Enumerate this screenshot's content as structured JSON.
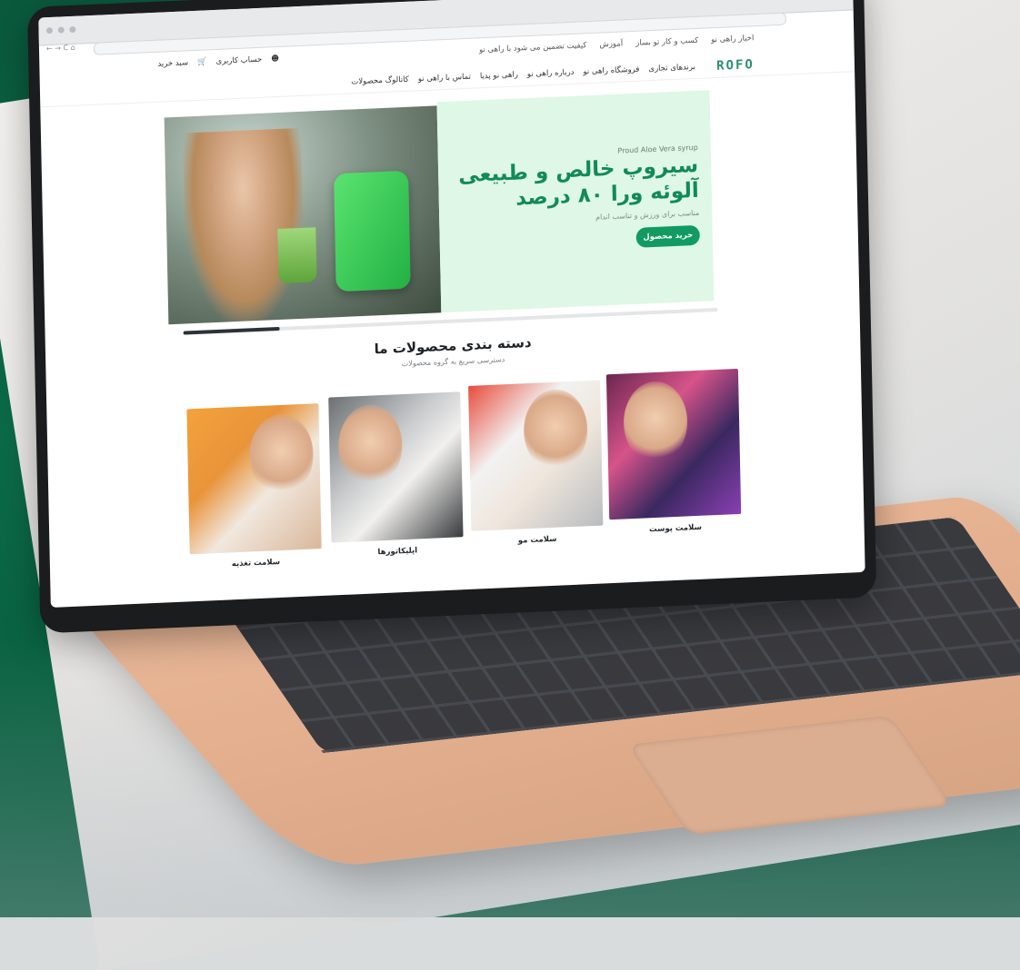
{
  "browser": {
    "window_dots": "● ● ●",
    "nav_buttons": "← → C ⌂"
  },
  "topbar": {
    "links": [
      "اخبار راهی نو",
      "کسب و کار تو بساز",
      "آموزش",
      "کیفیت تضمین می شود با راهی نو"
    ],
    "account": "حساب کاربری",
    "cart": "سبد خرید"
  },
  "mainnav": {
    "logo": "ROFO",
    "items": [
      "برندهای تجاری",
      "فروشگاه راهی نو",
      "درباره راهی نو",
      "راهی نو پدیا",
      "تماس با راهی نو",
      "کاتالوگ محصولات"
    ]
  },
  "hero": {
    "eyebrow": "Proud Aloe Vera syrup",
    "title": "سیروپ خالص و طبیعی آلوئه ورا ۸۰ درصد",
    "subtitle": "مناسب برای ورزش و تناسب اندام",
    "cta": "خرید محصول",
    "slider_progress": 0.18
  },
  "categories": {
    "title": "دسته بندی محصولات ما",
    "subtitle": "دسترسی سریع به گروه محصولات",
    "items": [
      {
        "label": "سلامت تغذیه"
      },
      {
        "label": "اپلیکاتورها"
      },
      {
        "label": "سلامت مو"
      },
      {
        "label": "سلامت پوست"
      }
    ]
  },
  "colors": {
    "brand_green": "#129a63",
    "hero_panel": "#dff7e6",
    "background_green": "#0b6a47"
  }
}
